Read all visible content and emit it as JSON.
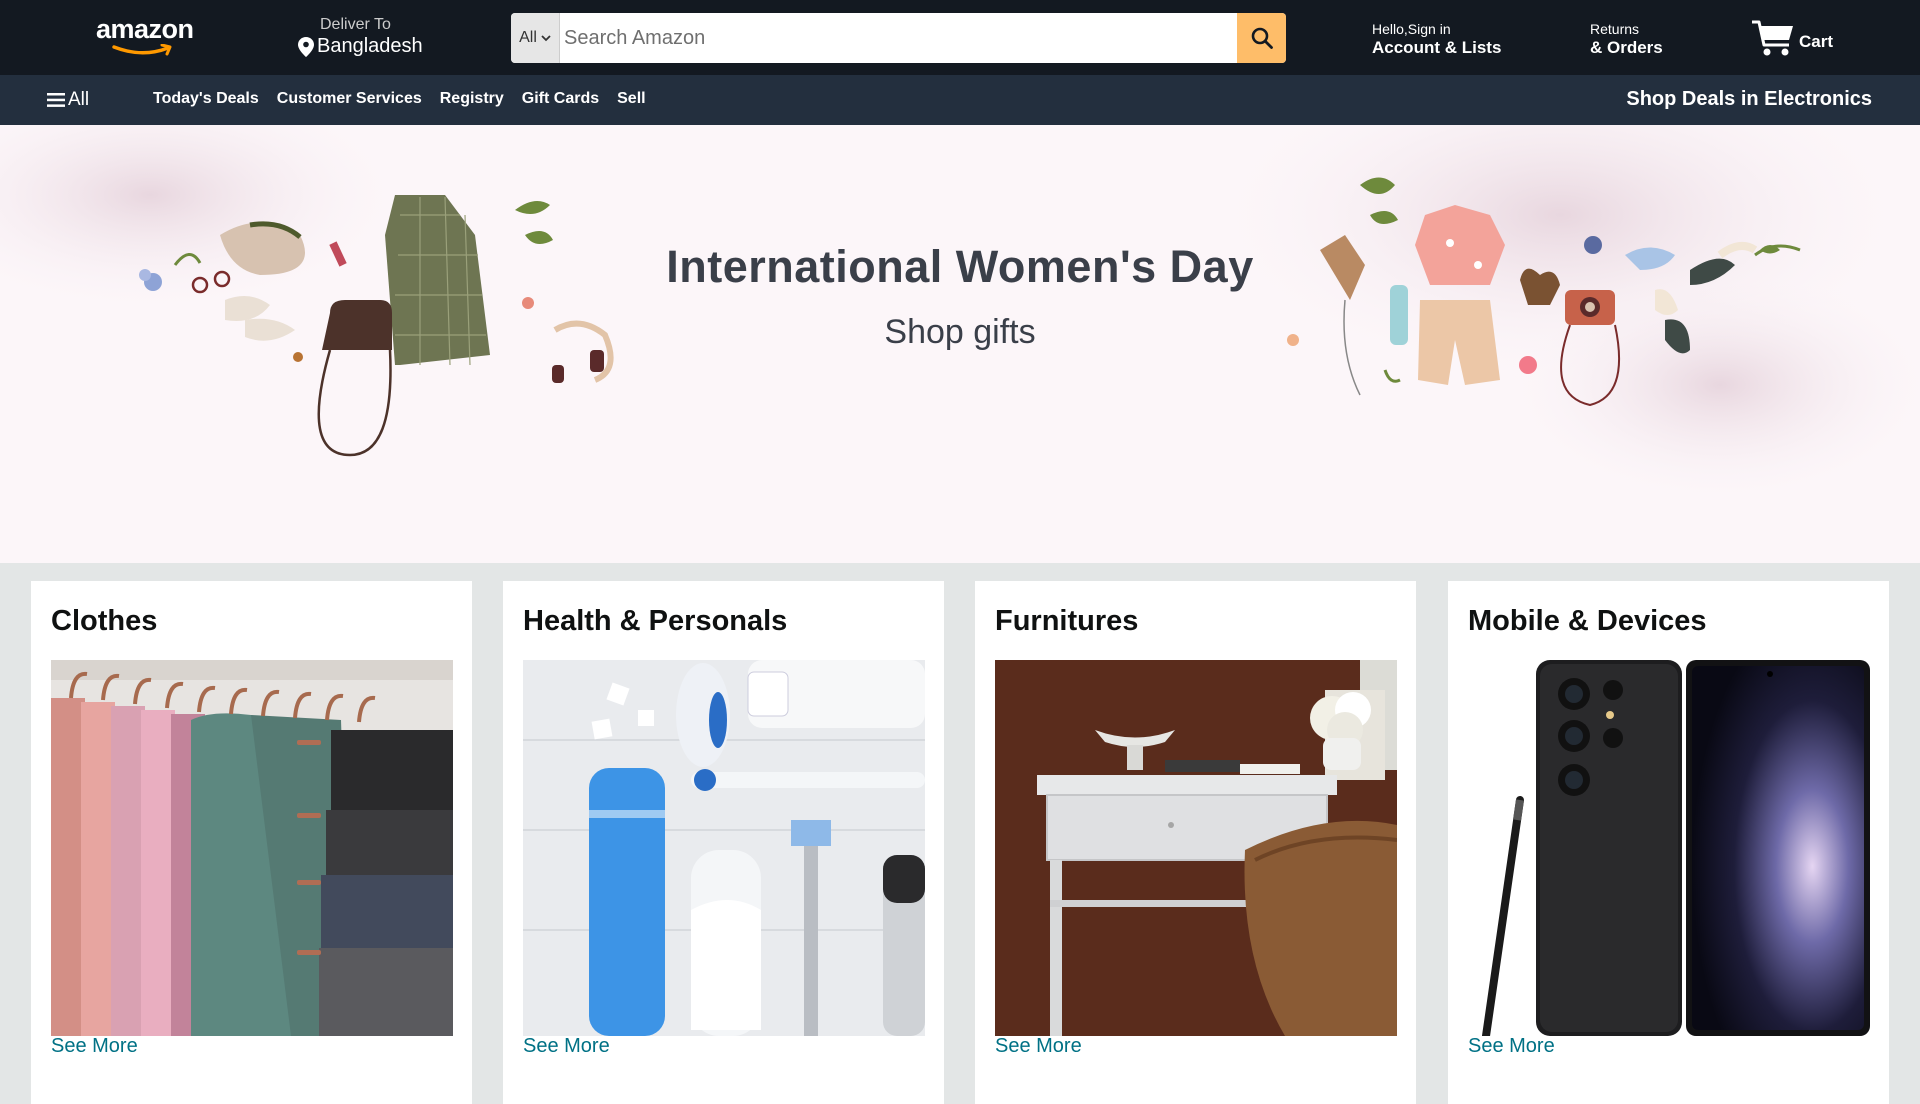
{
  "header": {
    "logo_text": "amazon",
    "deliver_label": "Deliver To",
    "deliver_location": "Bangladesh",
    "search": {
      "category": "All",
      "placeholder": "Search Amazon"
    },
    "account": {
      "greeting": "Hello,Sign in",
      "label": "Account & Lists"
    },
    "returns": {
      "line1": "Returns",
      "line2": "& Orders"
    },
    "cart": {
      "label": "Cart"
    },
    "accent_color": "#febd69"
  },
  "subnav": {
    "all_label": "All",
    "links": [
      "Today's Deals",
      "Customer Services",
      "Registry",
      "Gift Cards",
      "Sell"
    ],
    "promo": "Shop Deals in Electronics"
  },
  "hero": {
    "title": "International Women's Day",
    "subtitle": "Shop gifts"
  },
  "cards": [
    {
      "title": "Clothes",
      "link": "See More"
    },
    {
      "title": "Health & Personals",
      "link": "See More"
    },
    {
      "title": "Furnitures",
      "link": "See More"
    },
    {
      "title": "Mobile & Devices",
      "link": "See More"
    }
  ]
}
